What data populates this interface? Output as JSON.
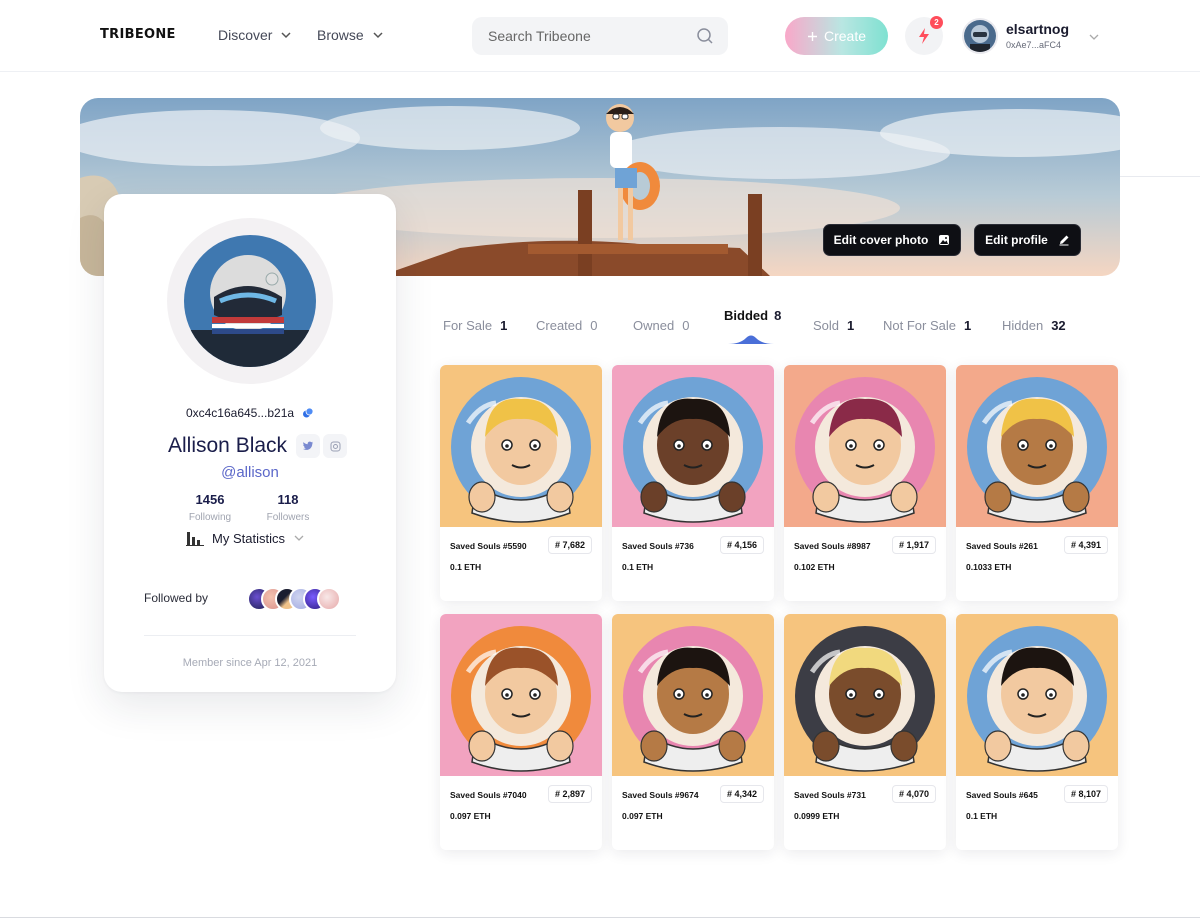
{
  "header": {
    "logo": "TRIBEONE",
    "nav": [
      {
        "label": "Discover"
      },
      {
        "label": "Browse"
      }
    ],
    "search": {
      "placeholder": "Search Tribeone"
    },
    "create_label": "Create",
    "notifications_count": "2",
    "user": {
      "name": "elsartnog",
      "address": "0xAe7...aFC4"
    }
  },
  "cover": {
    "edit_cover_label": "Edit cover photo",
    "edit_profile_label": "Edit profile"
  },
  "profile": {
    "address": "0xc4c16a645...b21a",
    "name": "Allison Black",
    "handle": "@allison",
    "following": {
      "value": "1456",
      "label": "Following"
    },
    "followers": {
      "value": "118",
      "label": "Followers"
    },
    "statistics_label": "My Statistics",
    "followed_by_label": "Followed by",
    "member_since": "Member since Apr 12, 2021"
  },
  "tabs": [
    {
      "label": "For Sale",
      "count": "1"
    },
    {
      "label": "Created",
      "count": "0"
    },
    {
      "label": "Owned",
      "count": "0"
    },
    {
      "label": "Bidded",
      "count": "8",
      "active": true
    },
    {
      "label": "Sold",
      "count": "1"
    },
    {
      "label": "Not For Sale",
      "count": "1"
    },
    {
      "label": "Hidden",
      "count": "32"
    }
  ],
  "items": [
    {
      "title": "Saved Souls #5590",
      "rank": "# 7,682",
      "price": "0.1 ETH",
      "bg": "#f6c47e",
      "ring": "#6fa3d6",
      "skin": "#f2c9a0",
      "hair": "#f0c247"
    },
    {
      "title": "Saved Souls #736",
      "rank": "# 4,156",
      "price": "0.1 ETH",
      "bg": "#f2a3c0",
      "ring": "#6fa3d6",
      "skin": "#6b4029",
      "hair": "#1c1410"
    },
    {
      "title": "Saved Souls #8987",
      "rank": "# 1,917",
      "price": "0.102 ETH",
      "bg": "#f3a98b",
      "ring": "#e886b0",
      "skin": "#f2c9a0",
      "hair": "#8a2a48"
    },
    {
      "title": "Saved Souls #261",
      "rank": "# 4,391",
      "price": "0.1033 ETH",
      "bg": "#f3a98b",
      "ring": "#6fa3d6",
      "skin": "#b57a45",
      "hair": "#f0c247"
    },
    {
      "title": "Saved Souls #7040",
      "rank": "# 2,897",
      "price": "0.097 ETH",
      "bg": "#f2a3c0",
      "ring": "#f08a3c",
      "skin": "#f2c9a0",
      "hair": "#9a5229"
    },
    {
      "title": "Saved Souls #9674",
      "rank": "# 4,342",
      "price": "0.097 ETH",
      "bg": "#f6c47e",
      "ring": "#e886b0",
      "skin": "#b57a45",
      "hair": "#1c1410"
    },
    {
      "title": "Saved Souls #731",
      "rank": "# 4,070",
      "price": "0.0999 ETH",
      "bg": "#f6c47e",
      "ring": "#3c3d45",
      "skin": "#7a4c2c",
      "hair": "#f1d97e"
    },
    {
      "title": "Saved Souls #645",
      "rank": "# 8,107",
      "price": "0.1 ETH",
      "bg": "#f6c47e",
      "ring": "#6fa3d6",
      "skin": "#f2c9a0",
      "hair": "#1c1410"
    }
  ]
}
